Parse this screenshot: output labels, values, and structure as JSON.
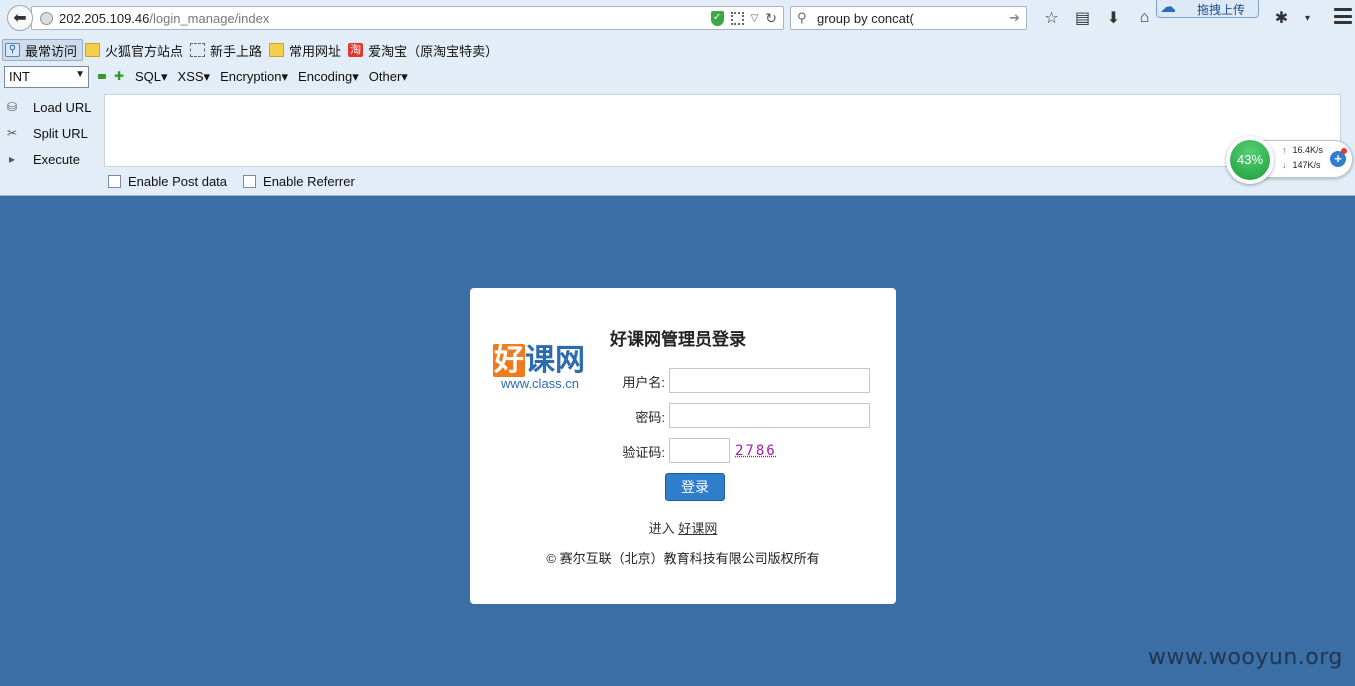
{
  "browser": {
    "url_host": "202.205.109.46",
    "url_path": "/login_manage/index",
    "search_text": "group by concat(",
    "upload_label": "拖拽上传",
    "bookmarks": [
      "最常访问",
      "火狐官方站点",
      "新手上路",
      "常用网址",
      "爱淘宝（原淘宝特卖）"
    ],
    "taobao_glyph": "淘"
  },
  "hackbar": {
    "select_value": "INT",
    "menus": [
      "SQL▾",
      "XSS▾",
      "Encryption▾",
      "Encoding▾",
      "Other▾"
    ],
    "actions": [
      "Load URL",
      "Split URL",
      "Execute"
    ],
    "checkboxes": [
      "Enable Post data",
      "Enable Referrer"
    ]
  },
  "speed_widget": {
    "percent": "43%",
    "upload": "16.4K/s",
    "download": "147K/s"
  },
  "login": {
    "logo_text": "好课网",
    "logo_url": "www.class.cn",
    "title": "好课网管理员登录",
    "username_label": "用户名:",
    "password_label": "密码:",
    "captcha_label": "验证码:",
    "captcha_code": "2786",
    "login_button": "登录",
    "enter_prefix": "进入",
    "enter_link": "好课网",
    "copyright": "© 赛尔互联（北京）教育科技有限公司版权所有"
  },
  "watermark": "www.wooyun.org",
  "colors": {
    "page_background": "#3b6ea5",
    "button_blue": "#2f7ecb",
    "logo_orange": "#f07a1c",
    "captcha_purple": "#a21caf"
  }
}
